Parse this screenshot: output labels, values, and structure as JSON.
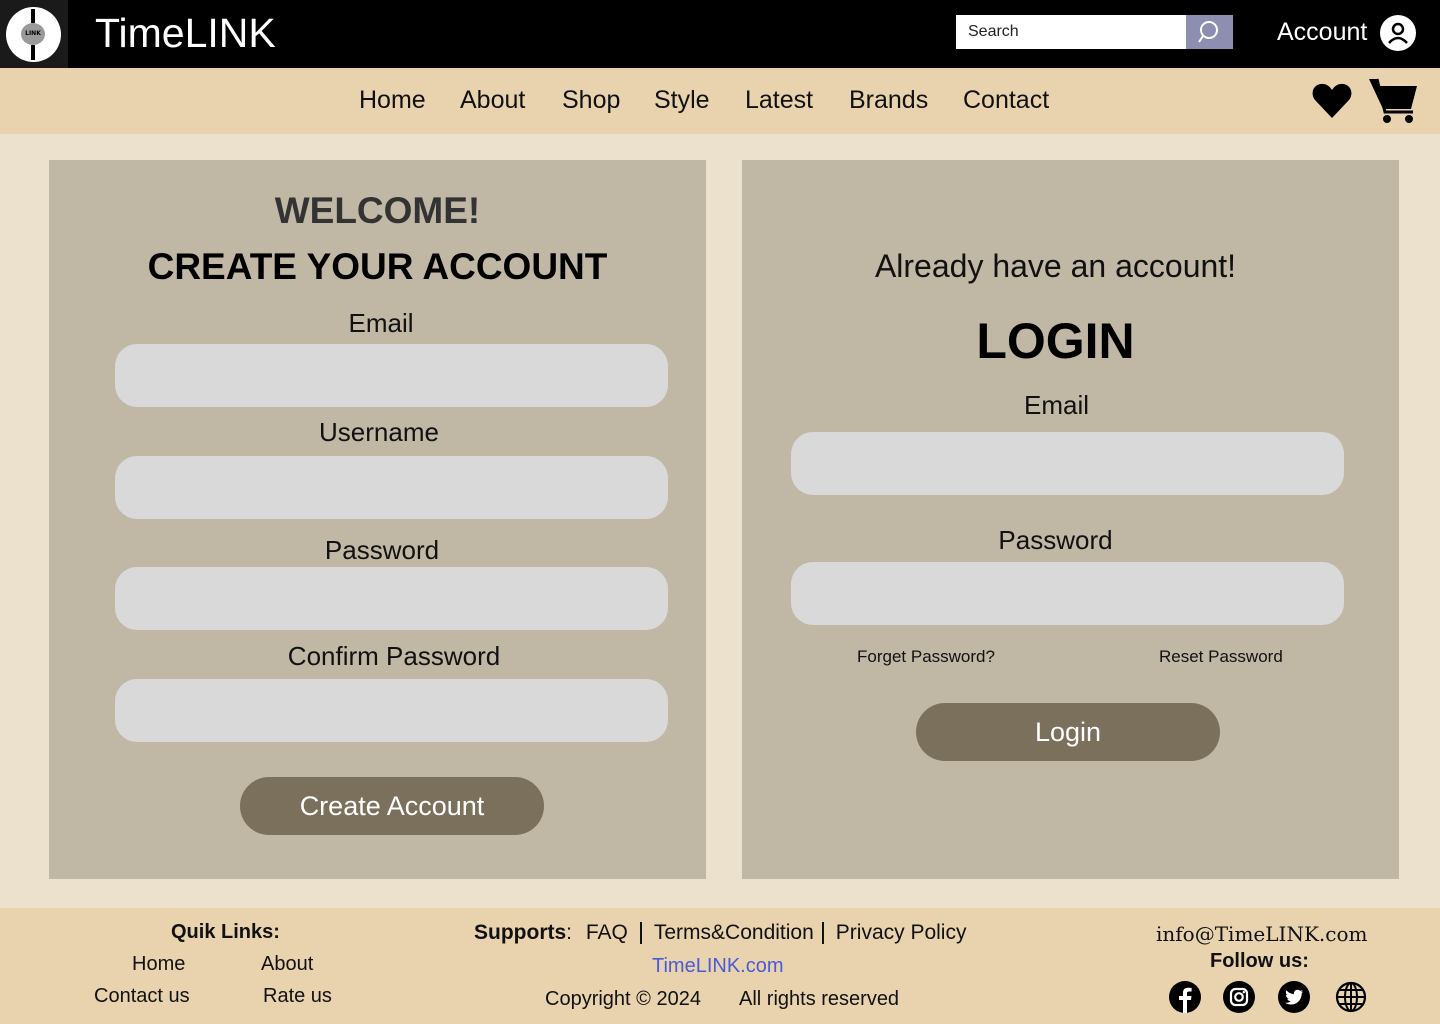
{
  "header": {
    "logo_text": "LINK",
    "brand": "TimeLINK",
    "search_placeholder": "Search",
    "search_icon": "search-icon",
    "account_label": "Account",
    "account_icon": "user-circle-icon",
    "colors": {
      "topbar": "#000000",
      "search_button": "#8e8fb0"
    }
  },
  "nav": {
    "items": [
      "Home",
      "About",
      "Shop",
      "Style",
      "Latest",
      "Brands",
      "Contact"
    ],
    "wishlist_icon": "heart-icon",
    "cart_icon": "cart-icon",
    "color": "#e9d3af"
  },
  "register": {
    "welcome": "WELCOME!",
    "title": "CREATE YOUR ACCOUNT",
    "email_label": "Email",
    "username_label": "Username",
    "password_label": "Password",
    "confirm_password_label": "Confirm Password",
    "email_value": "",
    "username_value": "",
    "password_value": "",
    "confirm_password_value": "",
    "submit_label": "Create Account"
  },
  "login": {
    "subtitle": "Already have an account!",
    "title": "LOGIN",
    "email_label": "Email",
    "password_label": "Password",
    "email_value": "",
    "password_value": "",
    "forget_password": "Forget Password?",
    "reset_password": "Reset Password",
    "submit_label": "Login"
  },
  "footer": {
    "quick_links_title": "Quik Links:",
    "quick_links": [
      "Home",
      "About",
      "Contact us",
      "Rate us"
    ],
    "supports_title": "Supports",
    "supports_colon": ":",
    "supports_links": [
      "FAQ",
      "Terms&Condition",
      "Privacy Policy"
    ],
    "site_link": "TimeLINK.com",
    "copyright": "Copyright © 2024",
    "rights": "All rights reserved",
    "email": "info@TimeLINK.com",
    "follow_title": "Follow us:",
    "social_icons": [
      "facebook-icon",
      "instagram-icon",
      "twitter-icon",
      "globe-icon"
    ],
    "colors": {
      "site_link": "#4a5bd4",
      "background": "#e9d3af"
    }
  }
}
